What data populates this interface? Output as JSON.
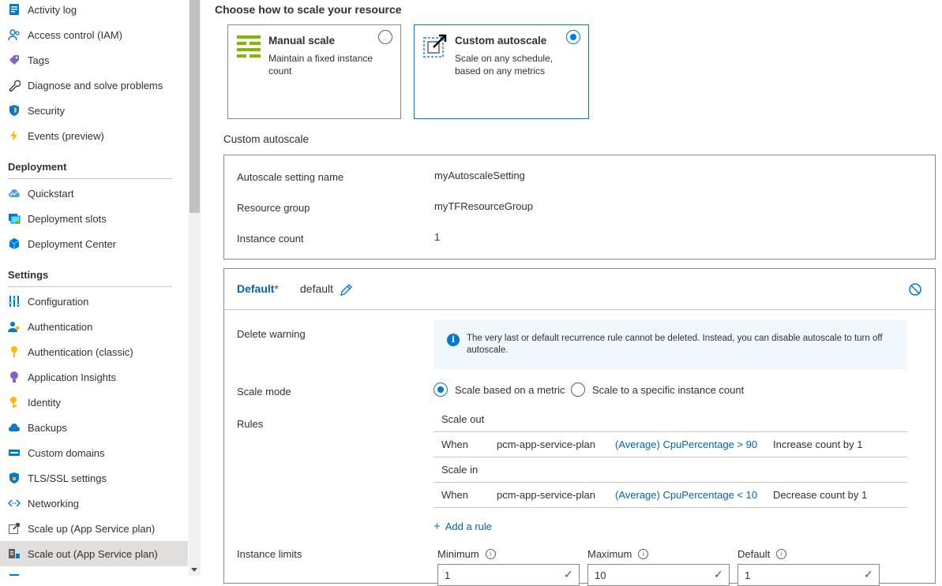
{
  "sidebar": {
    "items": [
      {
        "label": "Activity log",
        "icon": "activity-log-icon"
      },
      {
        "label": "Access control (IAM)",
        "icon": "people-icon"
      },
      {
        "label": "Tags",
        "icon": "tag-icon"
      },
      {
        "label": "Diagnose and solve problems",
        "icon": "wrench-icon"
      },
      {
        "label": "Security",
        "icon": "shield-icon"
      },
      {
        "label": "Events (preview)",
        "icon": "lightning-icon"
      }
    ],
    "deployment_heading": "Deployment",
    "deployment_items": [
      {
        "label": "Quickstart",
        "icon": "cloud-quickstart-icon"
      },
      {
        "label": "Deployment slots",
        "icon": "deployment-slots-icon"
      },
      {
        "label": "Deployment Center",
        "icon": "cube-icon"
      }
    ],
    "settings_heading": "Settings",
    "settings_items": [
      {
        "label": "Configuration",
        "icon": "sliders-icon"
      },
      {
        "label": "Authentication",
        "icon": "user-key-icon"
      },
      {
        "label": "Authentication (classic)",
        "icon": "key-icon"
      },
      {
        "label": "Application Insights",
        "icon": "lightbulb-icon"
      },
      {
        "label": "Identity",
        "icon": "identity-key-icon"
      },
      {
        "label": "Backups",
        "icon": "cloud-backup-icon"
      },
      {
        "label": "Custom domains",
        "icon": "domain-icon"
      },
      {
        "label": "TLS/SSL settings",
        "icon": "shield-lock-icon"
      },
      {
        "label": "Networking",
        "icon": "networking-icon"
      },
      {
        "label": "Scale up (App Service plan)",
        "icon": "scale-up-icon"
      },
      {
        "label": "Scale out (App Service plan)",
        "icon": "scale-out-icon",
        "selected": true
      }
    ]
  },
  "main": {
    "choose_title": "Choose how to scale your resource",
    "manual": {
      "title": "Manual scale",
      "desc": "Maintain a fixed instance count"
    },
    "custom": {
      "title": "Custom autoscale",
      "desc": "Scale on any schedule, based on any metrics"
    },
    "section_label": "Custom autoscale",
    "setting_name_label": "Autoscale setting name",
    "setting_name_value": "myAutoscaleSetting",
    "resource_group_label": "Resource group",
    "resource_group_value": "myTFResourceGroup",
    "instance_count_label": "Instance count",
    "instance_count_value": "1",
    "profile": {
      "name": "Default",
      "star": "*",
      "subtitle": "default"
    },
    "delete_warning_label": "Delete warning",
    "warning_text": "The very last or default recurrence rule cannot be deleted. Instead, you can disable autoscale to turn off autoscale.",
    "scale_mode_label": "Scale mode",
    "scale_mode_options": [
      "Scale based on a metric",
      "Scale to a specific instance count"
    ],
    "rules_label": "Rules",
    "scale_out_label": "Scale out",
    "scale_in_label": "Scale in",
    "rule_out": {
      "when": "When",
      "resource": "pcm-app-service-plan",
      "metric": "(Average) CpuPercentage > 90",
      "action": "Increase count by 1"
    },
    "rule_in": {
      "when": "When",
      "resource": "pcm-app-service-plan",
      "metric": "(Average) CpuPercentage < 10",
      "action": "Decrease count by 1"
    },
    "add_rule": "Add a rule",
    "instance_limits_label": "Instance limits",
    "minimum_label": "Minimum",
    "maximum_label": "Maximum",
    "default_label": "Default",
    "minimum_value": "1",
    "maximum_value": "10",
    "default_value": "1"
  },
  "colors": {
    "accent": "#0078d4",
    "link": "#0063b1",
    "selected_bg": "#e1dfdd",
    "warning_bg": "#eff6fc",
    "valid": "#107c10"
  }
}
